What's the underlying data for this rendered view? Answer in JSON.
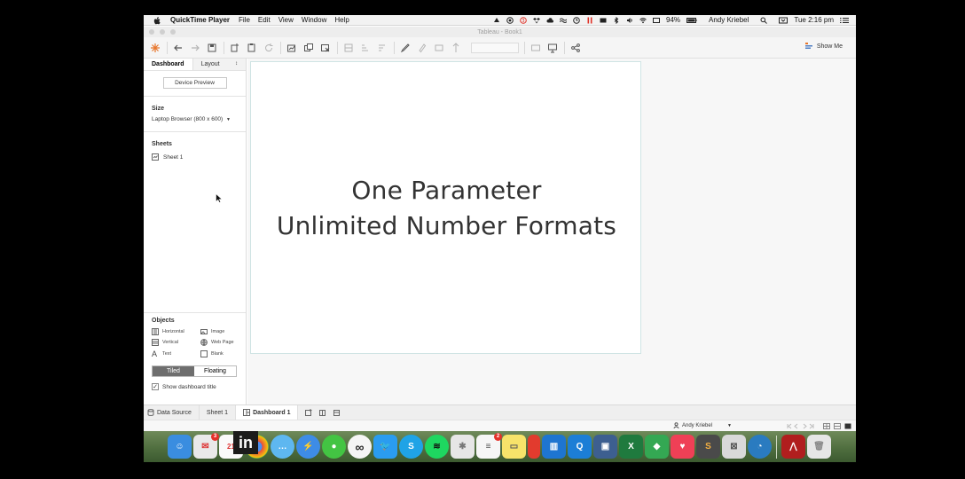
{
  "menubar": {
    "app": "QuickTime Player",
    "menus": [
      "File",
      "Edit",
      "View",
      "Window",
      "Help"
    ],
    "battery": "94%",
    "user": "Andy Kriebel",
    "clock": "Tue 2:16 pm"
  },
  "window": {
    "title": "Tableau - Book1"
  },
  "toolbar": {
    "show_me": "Show Me"
  },
  "pane": {
    "tab_dashboard": "Dashboard",
    "tab_layout": "Layout",
    "tab_layout_arrow": "↕",
    "device_preview": "Device Preview",
    "size_title": "Size",
    "size_value": "Laptop Browser (800 x 600)",
    "sheets_title": "Sheets",
    "sheet_item": "Sheet 1",
    "objects_title": "Objects",
    "objects": [
      "Horizontal",
      "Image",
      "Vertical",
      "Web Page",
      "Text",
      "Blank"
    ],
    "tiled": "Tiled",
    "floating": "Floating",
    "show_title": "Show dashboard title"
  },
  "dashboard": {
    "line1": "One Parameter",
    "line2": "Unlimited Number Formats"
  },
  "bottom_tabs": {
    "data_source": "Data Source",
    "sheet1": "Sheet 1",
    "dashboard1": "Dashboard 1"
  },
  "status": {
    "user": "Andy Kriebel"
  },
  "dock": {
    "mail_badge": "3",
    "notes_badge": "2",
    "overlay": "in"
  },
  "colors": {
    "accent": "#6e6e6e",
    "tableau_border": "#cfe4e4",
    "dock_bg": "#4d6c3d"
  }
}
